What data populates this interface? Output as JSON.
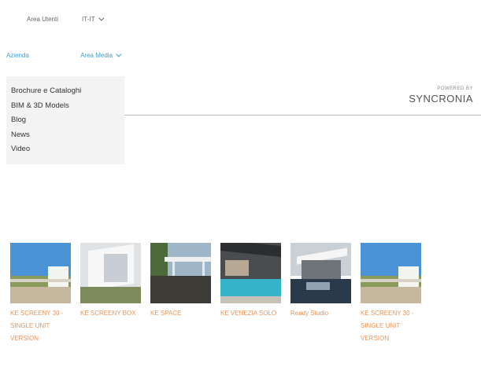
{
  "topbar": {
    "area_label": "Area Utenti",
    "language": "IT-IT"
  },
  "nav": {
    "items": [
      "Azienda",
      "Area Media"
    ]
  },
  "dropdown": {
    "items": [
      "Brochure e Cataloghi",
      "BIM & 3D Models",
      "Blog",
      "News",
      "Video"
    ]
  },
  "powered": {
    "label": "POWERED BY",
    "brand": "SYNCRONIA"
  },
  "products": [
    {
      "title": "KE SCREENY 30 - SINGLE UNIT VERSION"
    },
    {
      "title": "KE SCREENY BOX"
    },
    {
      "title": "KE SPACE"
    },
    {
      "title": "KE VENEZIA SOLO"
    },
    {
      "title": "Ready Studio"
    },
    {
      "title": "KE SCREENY 30 - SINGLE UNIT VERSION"
    }
  ],
  "colors": {
    "link": "#3a9fc9",
    "product_title": "#e8955a",
    "dropdown_bg": "#f3f3f3",
    "divider": "#b8b8b8"
  }
}
